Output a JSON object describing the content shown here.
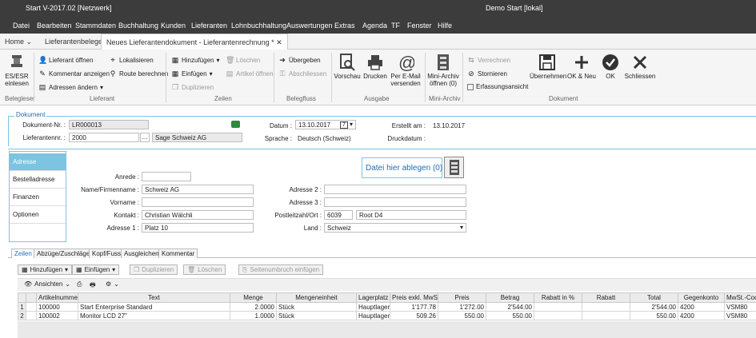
{
  "title": {
    "left": "Start V-2017.02 [Netzwerk]",
    "center": "Demo Start [lokal]"
  },
  "menu": [
    "Datei",
    "Bearbeiten",
    "Stammdaten",
    "Buchhaltung",
    "Kunden",
    "Lieferanten",
    "Lohnbuchhaltung",
    "Auswertungen",
    "Extras",
    "Agenda",
    "TF",
    "Fenster",
    "Hilfe"
  ],
  "doc_tabs": {
    "home": "Home",
    "t1": "Lieferantenbelege",
    "t2": "Neues Lieferantendokument - Lieferantenrechnung *"
  },
  "ribbon": {
    "belegleser": {
      "btn": "ES/ESR einlesen",
      "group": "Belegleser"
    },
    "lieferant": {
      "oeffnen": "Lieferant öffnen",
      "kommentar": "Kommentar anzeigen",
      "adressen": "Adressen ändern",
      "lokalisieren": "Lokalisieren",
      "route": "Route berechnen",
      "group": "Lieferant"
    },
    "zeilen": {
      "hinzufuegen": "Hinzufügen",
      "einfuegen": "Einfügen",
      "duplizieren": "Duplizieren",
      "loeschen": "Löschen",
      "artikel": "Artikel öffnen",
      "group": "Zeilen"
    },
    "belegfluss": {
      "uebergeben": "Übergeben",
      "abschliessen": "Abschliessen",
      "group": "Belegfluss"
    },
    "ausgabe": {
      "vorschau": "Vorschau",
      "drucken": "Drucken",
      "email": "Per E-Mail versenden",
      "group": "Ausgabe"
    },
    "miniarchiv": {
      "btn": "Mini-Archiv öffnen (0)",
      "group": "Mini-Archiv"
    },
    "dokument": {
      "verrechnen": "Verrechnen",
      "stornieren": "Stornieren",
      "erfassung": "Erfassungsansicht",
      "uebernehmen": "Übernehmen",
      "okneu": "OK & Neu",
      "ok": "OK",
      "schliessen": "Schliessen",
      "group": "Dokument"
    }
  },
  "dokument": {
    "legend": "Dokument",
    "dok_nr_label": "Dokument-Nr. :",
    "dok_nr": "LR000013",
    "lieferant_label": "Lieferantennr. :",
    "lieferant_nr": "2000",
    "lieferant_name": "Sage Schweiz AG",
    "datum_label": "Datum :",
    "datum": "13.10.2017",
    "sprache_label": "Sprache :",
    "sprache": "Deutsch (Schweiz)",
    "erstellt_label": "Erstellt am :",
    "erstellt": "13.10.2017",
    "druck_label": "Druckdatum :"
  },
  "nav": [
    "Adresse",
    "Bestelladresse",
    "Finanzen",
    "Optionen"
  ],
  "drop": "Datei hier ablegen (0)",
  "adresse": {
    "anrede_label": "Anrede :",
    "anrede": "",
    "name_label": "Name/Firmenname :",
    "name": "Schweiz AG",
    "vorname_label": "Vorname :",
    "vorname": "",
    "kontakt_label": "Kontakt :",
    "kontakt": "Christian Wälchli",
    "adresse1_label": "Adresse 1 :",
    "adresse1": "Platz 10",
    "adresse2_label": "Adresse 2 :",
    "adresse2": "",
    "adresse3_label": "Adresse 3 :",
    "adresse3": "",
    "plz_label": "Postleitzahl/Ort :",
    "plz": "6039",
    "ort": "Root D4",
    "land_label": "Land :",
    "land": "Schweiz"
  },
  "bottom_tabs": [
    "Zeilen",
    "Abzüge/Zuschläge",
    "Kopf/Fuss",
    "Ausgleichen",
    "Kommentar"
  ],
  "grid_toolbar": {
    "hinzufuegen": "Hinzufügen",
    "einfuegen": "Einfügen",
    "duplizieren": "Duplizieren",
    "loeschen": "Löschen",
    "seitenumbruch": "Seitenumbruch einfügen",
    "ansichten": "Ansichten"
  },
  "grid": {
    "columns": [
      "",
      "Artikelnummer",
      "Text",
      "Menge",
      "Mengeneinheit",
      "Lagerplatz",
      "Preis exkl. MwSt.",
      "Preis",
      "Betrag",
      "Rabatt in %",
      "Rabatt",
      "Total",
      "Gegenkonto",
      "MwSt.-Code"
    ],
    "rows": [
      [
        "1",
        "100000",
        "Start Enterprise Standard",
        "2.0000",
        "Stück",
        "Hauptlager",
        "1'177.78",
        "1'272.00",
        "2'544.00",
        "",
        "",
        "2'544.00",
        "4200",
        "VSM80"
      ],
      [
        "2",
        "100002",
        "Monitor LCD 27\"",
        "1.0000",
        "Stück",
        "Hauptlager",
        "509.26",
        "550.00",
        "550.00",
        "",
        "",
        "550.00",
        "4200",
        "VSM80"
      ]
    ]
  },
  "colors": {
    "dark": "#3c3c3c",
    "accent": "#1e6eb5",
    "nav_selected": "#7cc4e0"
  }
}
